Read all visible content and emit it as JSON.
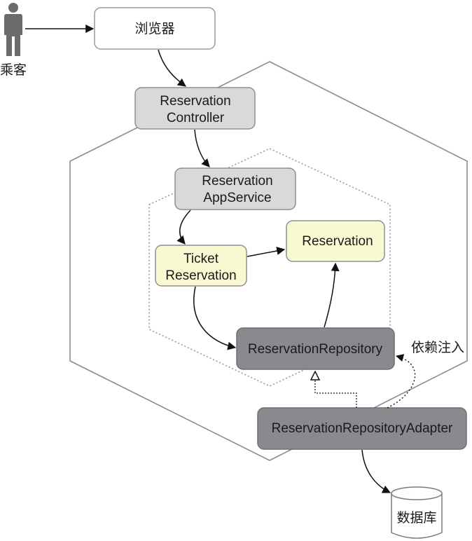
{
  "actor": {
    "label": "乘客",
    "icon": "person-icon"
  },
  "browser": {
    "label": "浏览器"
  },
  "controller": {
    "line1": "Reservation",
    "line2": "Controller"
  },
  "app_service": {
    "line1": "Reservation",
    "line2": "AppService"
  },
  "ticket_reservation": {
    "line1": "Ticket",
    "line2": "Reservation"
  },
  "reservation": {
    "label": "Reservation"
  },
  "repository": {
    "label": "ReservationRepository"
  },
  "adapter": {
    "label": "ReservationRepositoryAdapter"
  },
  "database": {
    "label": "数据库",
    "icon": "database-icon"
  },
  "injection_note": {
    "label": "依赖注入"
  },
  "colors": {
    "light_gray_box": "#d9d9dc",
    "yellow_box": "#fafad2",
    "dark_gray_box": "#8a8a8e",
    "hexagon_stroke": "#8c8c8c",
    "person": "#6b6b6b"
  }
}
